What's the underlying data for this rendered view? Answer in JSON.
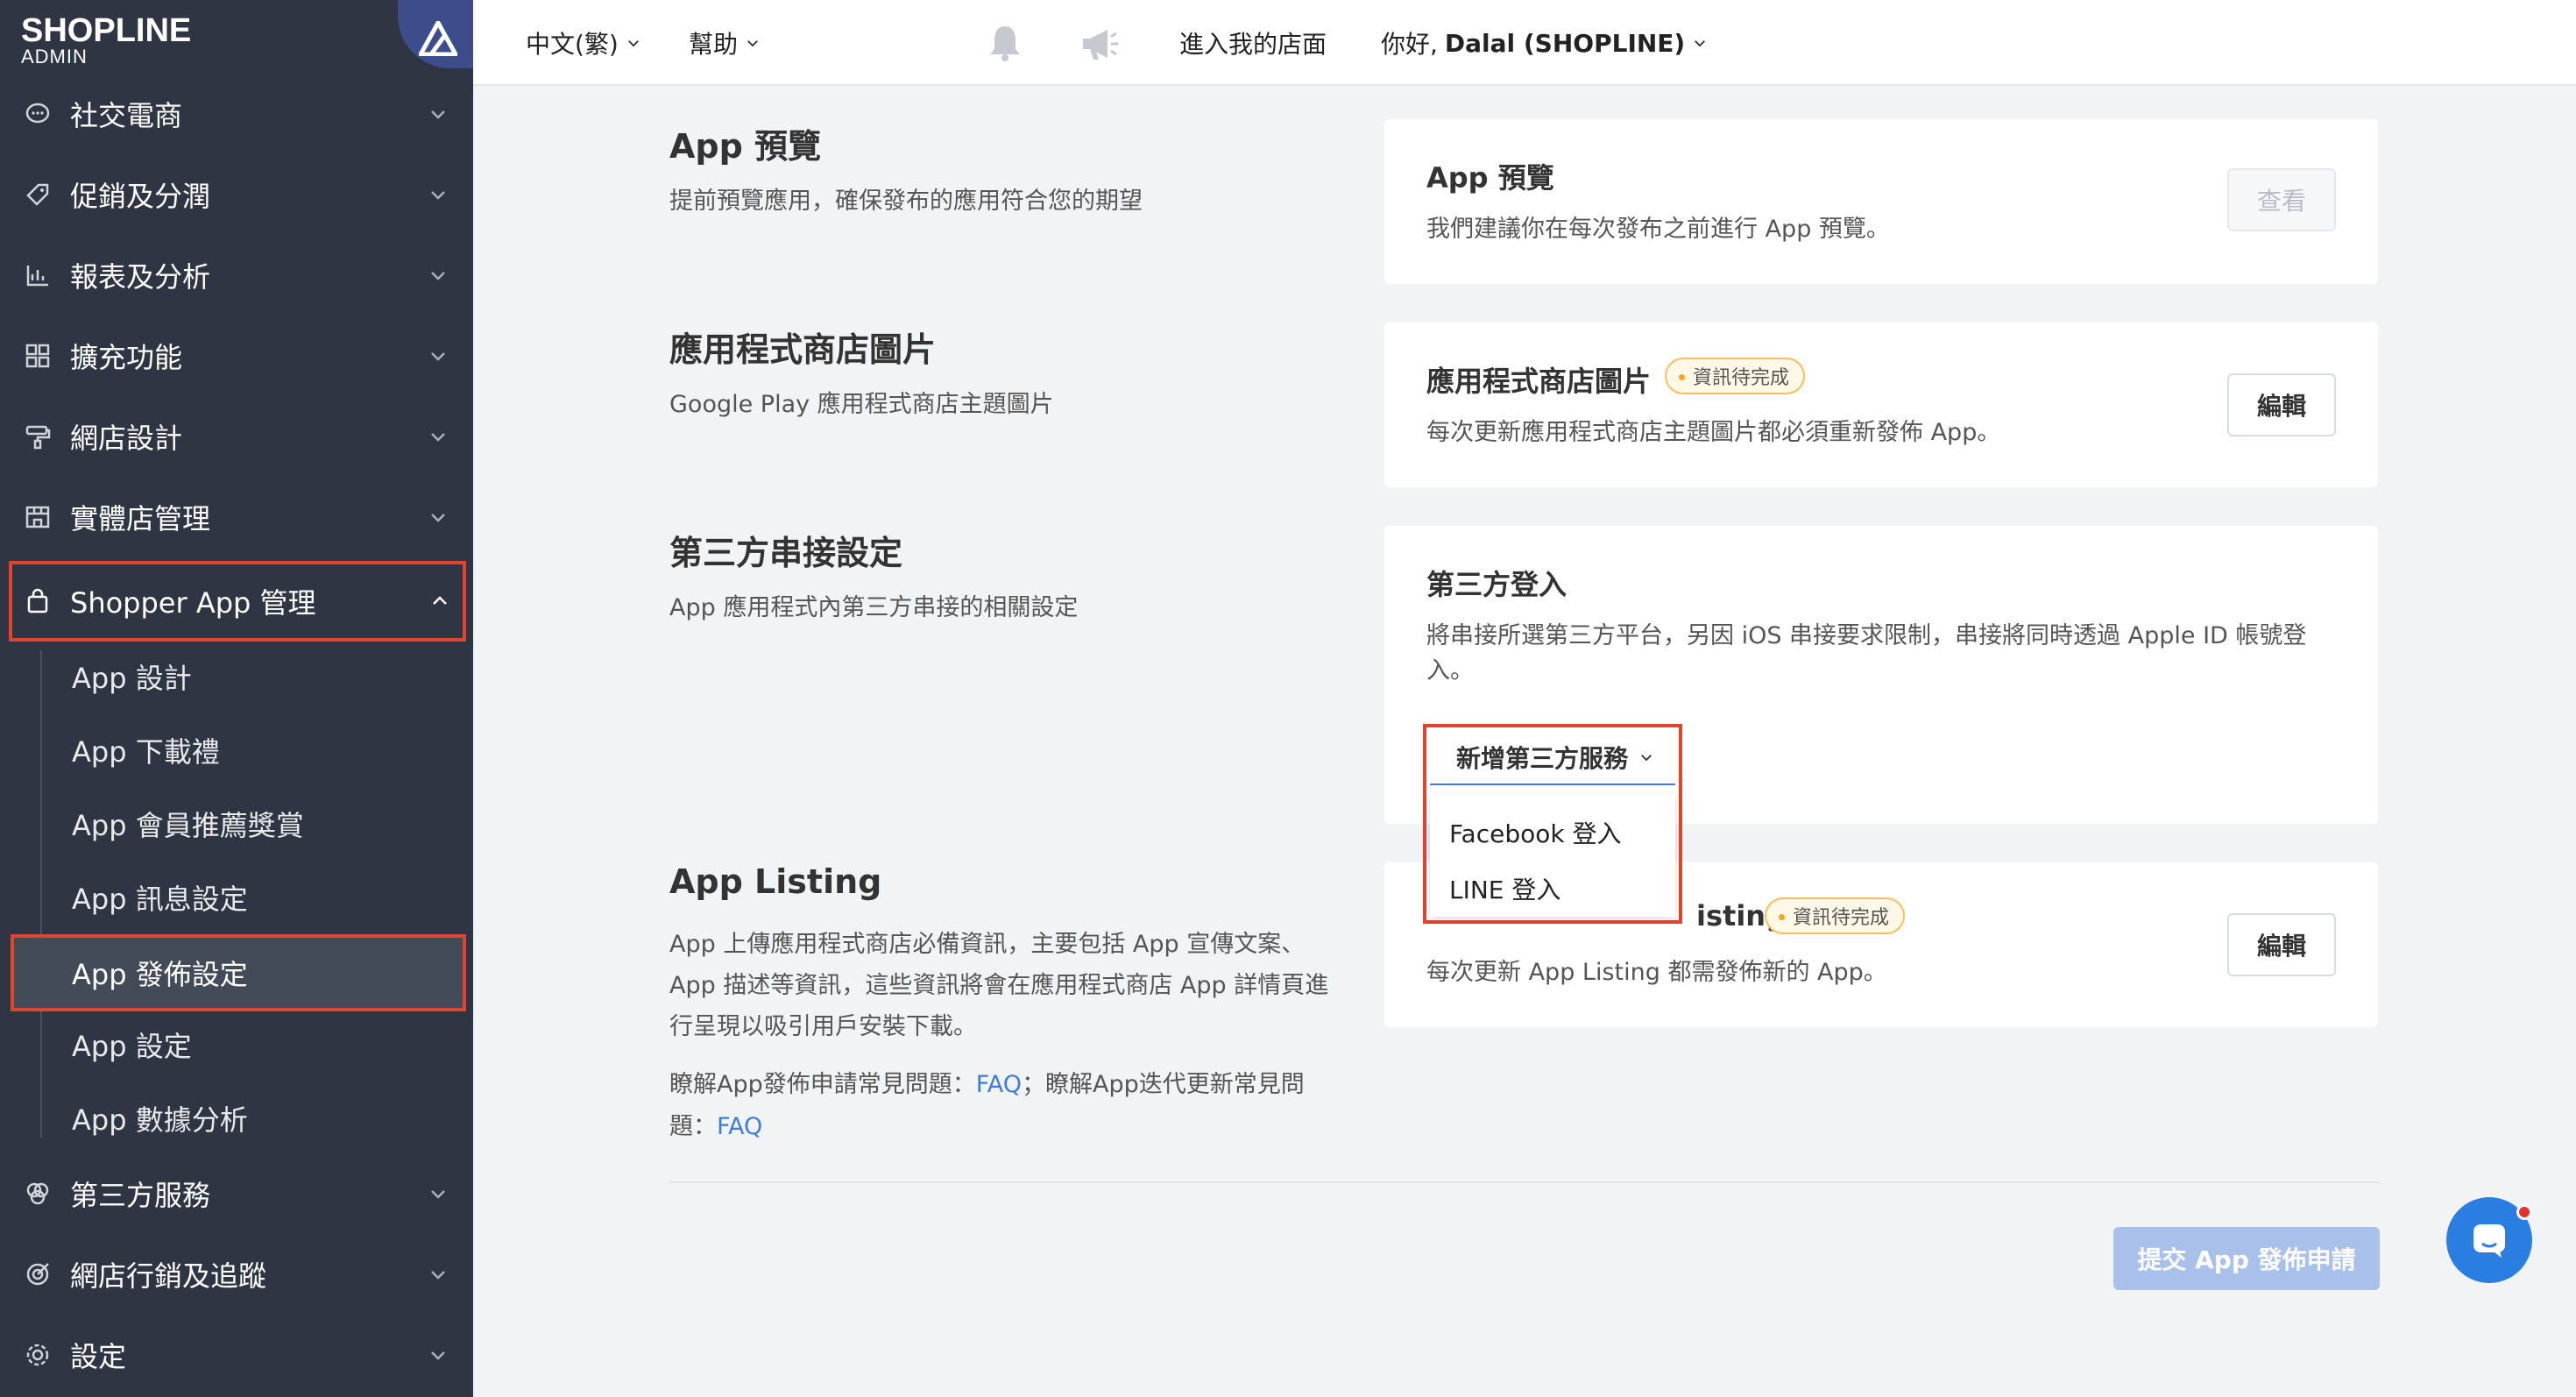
{
  "brand": {
    "name": "SHOPLINE",
    "sub": "ADMIN"
  },
  "topbar": {
    "language": "中文(繁)",
    "help": "幫助",
    "store_link": "進入我的店面",
    "greeting": "你好,",
    "user": "Dalal (SHOPLINE)"
  },
  "sidebar": {
    "items": [
      {
        "label": "社交電商",
        "icon": "chat-icon"
      },
      {
        "label": "促銷及分潤",
        "icon": "tag-icon"
      },
      {
        "label": "報表及分析",
        "icon": "chart-icon"
      },
      {
        "label": "擴充功能",
        "icon": "apps-icon"
      },
      {
        "label": "網店設計",
        "icon": "brush-icon"
      },
      {
        "label": "實體店管理",
        "icon": "store-icon"
      },
      {
        "label": "Shopper App 管理",
        "icon": "bag-icon"
      },
      {
        "label": "第三方服務",
        "icon": "circles-icon"
      },
      {
        "label": "網店行銷及追蹤",
        "icon": "target-icon"
      },
      {
        "label": "設定",
        "icon": "gear-icon"
      }
    ],
    "sub_items": [
      "App 設計",
      "App 下載禮",
      "App 會員推薦獎賞",
      "App 訊息設定",
      "App 發佈設定",
      "App 設定",
      "App 數據分析"
    ]
  },
  "sections": {
    "preview": {
      "title": "App 預覽",
      "desc": "提前預覽應用，確保發布的應用符合您的期望"
    },
    "store_images": {
      "title": "應用程式商店圖片",
      "desc": "Google Play 應用程式商店主題圖片"
    },
    "third_party": {
      "title": "第三方串接設定",
      "desc": "App 應用程式內第三方串接的相關設定"
    },
    "listing": {
      "title": "App Listing",
      "desc1": "App 上傳應用程式商店必備資訊，主要包括 App 宣傳文案、",
      "desc2": "App 描述等資訊，這些資訊將會在應用程式商店 App 詳情頁進",
      "desc3": "行呈現以吸引用戶安裝下載。",
      "faq_prefix1": "瞭解App發佈申請常見問題：",
      "faq_link1": "FAQ",
      "faq_mid": "；瞭解App迭代更新常見問",
      "faq_prefix2": "題：",
      "faq_link2": "FAQ"
    }
  },
  "cards": {
    "preview": {
      "title": "App 預覽",
      "desc": "我們建議你在每次發布之前進行 App 預覽。",
      "button": "查看"
    },
    "store_images": {
      "title": "應用程式商店圖片",
      "badge": "資訊待完成",
      "desc": "每次更新應用程式商店主題圖片都必須重新發佈 App。",
      "button": "編輯"
    },
    "third_party": {
      "title": "第三方登入",
      "desc1": "將串接所選第三方平台，另因 iOS 串接要求限制，串接將同時透過 Apple ID 帳號登",
      "desc2": "入。",
      "dropdown": "新增第三方服務",
      "options": [
        "Facebook 登入",
        "LINE 登入"
      ]
    },
    "listing": {
      "title_visible": "isting",
      "badge": "資訊待完成",
      "desc": "每次更新 App Listing 都需發佈新的 App。",
      "button": "編輯"
    }
  },
  "submit_button": "提交 App 發佈申請",
  "colors": {
    "sidebar": "#2f3543",
    "accent_red": "#e0452e",
    "link": "#3e7ed8",
    "badge": "#f2c15e"
  }
}
